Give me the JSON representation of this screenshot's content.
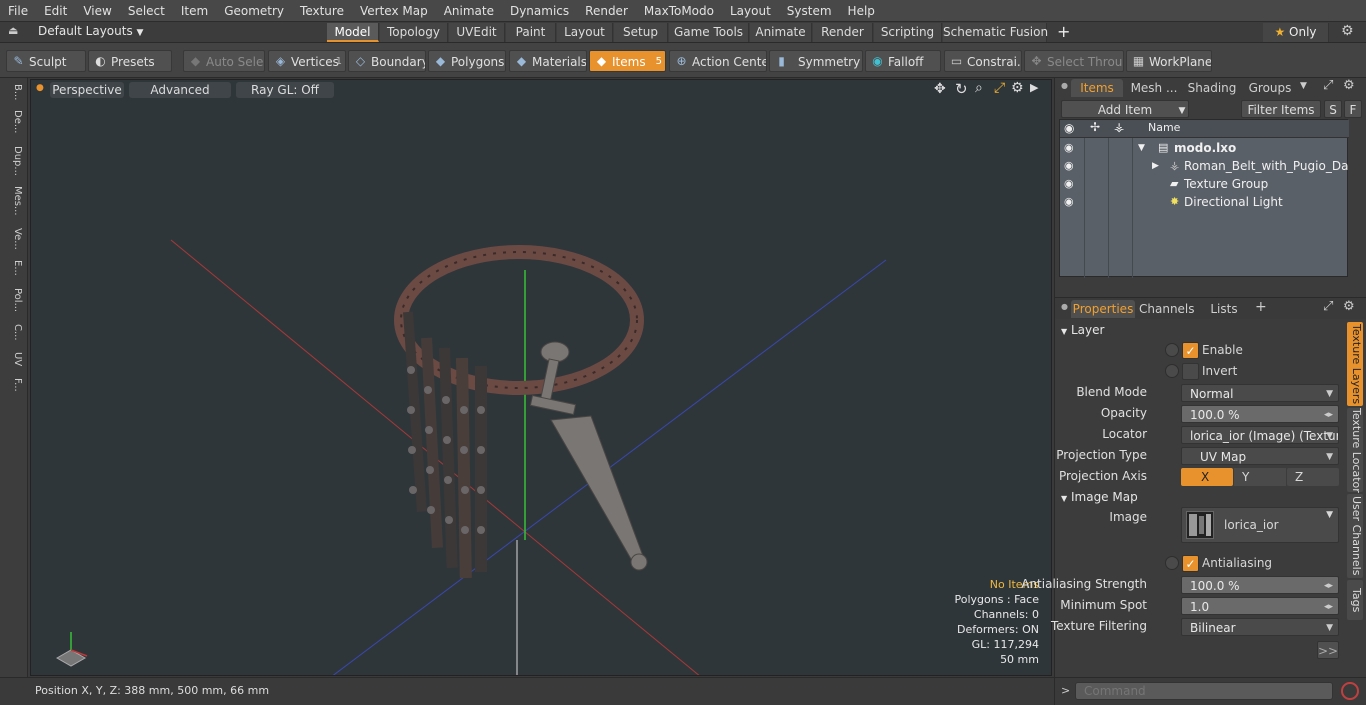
{
  "menu": [
    "File",
    "Edit",
    "View",
    "Select",
    "Item",
    "Geometry",
    "Texture",
    "Vertex Map",
    "Animate",
    "Dynamics",
    "Render",
    "MaxToModo",
    "Layout",
    "System",
    "Help"
  ],
  "layout": {
    "preset": "Default Layouts",
    "tabs": [
      "Model",
      "Topology",
      "UVEdit",
      "Paint",
      "Layout",
      "Setup",
      "Game Tools",
      "Animate",
      "Render",
      "Scripting",
      "Schematic Fusion"
    ],
    "active_tab": "Model",
    "add": "+",
    "only_label": "Only",
    "star": "★"
  },
  "toolbar": {
    "sculpt": "Sculpt",
    "presets": "Presets",
    "auto_select": "Auto Select",
    "vertices": "Vertices",
    "vertices_count": "1",
    "boundary": "Boundary",
    "polygons": "Polygons",
    "materials": "Materials",
    "items": "Items",
    "items_count": "5",
    "action_center": "Action Center",
    "symmetry": "Symmetry",
    "falloff": "Falloff",
    "constraints": "Constrai...",
    "select_through": "Select Through",
    "workplane": "WorkPlane"
  },
  "left_tabs": [
    "B...",
    "De...",
    "Dup...",
    "Mes...",
    "Ve...",
    "E...",
    "Pol...",
    "C...",
    "UV",
    "F..."
  ],
  "viewport": {
    "perspective": "Perspective",
    "advanced": "Advanced",
    "raygl": "Ray GL: Off",
    "info": {
      "no_items": "No Items",
      "polygons": "Polygons : Face",
      "channels": "Channels: 0",
      "deformers": "Deformers: ON",
      "gl": "GL: 117,294",
      "scale": "50 mm"
    }
  },
  "status": {
    "position": "Position X, Y, Z:  388 mm, 500 mm, 66 mm"
  },
  "items_panel": {
    "tabs": [
      "Items",
      "Mesh ...",
      "Shading",
      "Groups"
    ],
    "active_tab": "Items",
    "add_item": "Add Item",
    "filter_items": "Filter Items",
    "s_button": "S",
    "f_button": "F",
    "name_col": "Name",
    "rows": [
      {
        "name": "modo.lxo",
        "bold": true
      },
      {
        "name": "Roman_Belt_with_Pugio_Dagg ...",
        "bold": false
      },
      {
        "name": "Texture Group",
        "bold": false
      },
      {
        "name": "Directional Light",
        "bold": false
      }
    ]
  },
  "properties": {
    "tabs": [
      "Properties",
      "Channels",
      "Lists"
    ],
    "active_tab": "Properties",
    "add": "+",
    "layer_section": "Layer",
    "enable": "Enable",
    "invert": "Invert",
    "blend_mode_label": "Blend Mode",
    "blend_mode": "Normal",
    "opacity_label": "Opacity",
    "opacity": "100.0 %",
    "locator_label": "Locator",
    "locator": "lorica_ior (Image) (Texture)",
    "projection_type_label": "Projection Type",
    "projection_type": "UV Map",
    "projection_axis_label": "Projection Axis",
    "axes": [
      "X",
      "Y",
      "Z"
    ],
    "image_map_section": "Image Map",
    "image_label": "Image",
    "image": "lorica_ior",
    "antialiasing": "Antialiasing",
    "aa_strength_label": "Antialiasing Strength",
    "aa_strength": "100.0 %",
    "min_spot_label": "Minimum Spot",
    "min_spot": "1.0",
    "filtering_label": "Texture Filtering",
    "filtering": "Bilinear",
    "more": ">>",
    "side_tabs": [
      "Texture Layers",
      "Texture Locator",
      "User Channels",
      "Tags"
    ],
    "command_placeholder": "Command"
  },
  "colors": {
    "accent": "#e8922e",
    "viewport_bg": "#2f363a",
    "axis_x": "#c03a3a",
    "axis_y": "#3ac03a",
    "axis_z": "#3a5ac0"
  }
}
